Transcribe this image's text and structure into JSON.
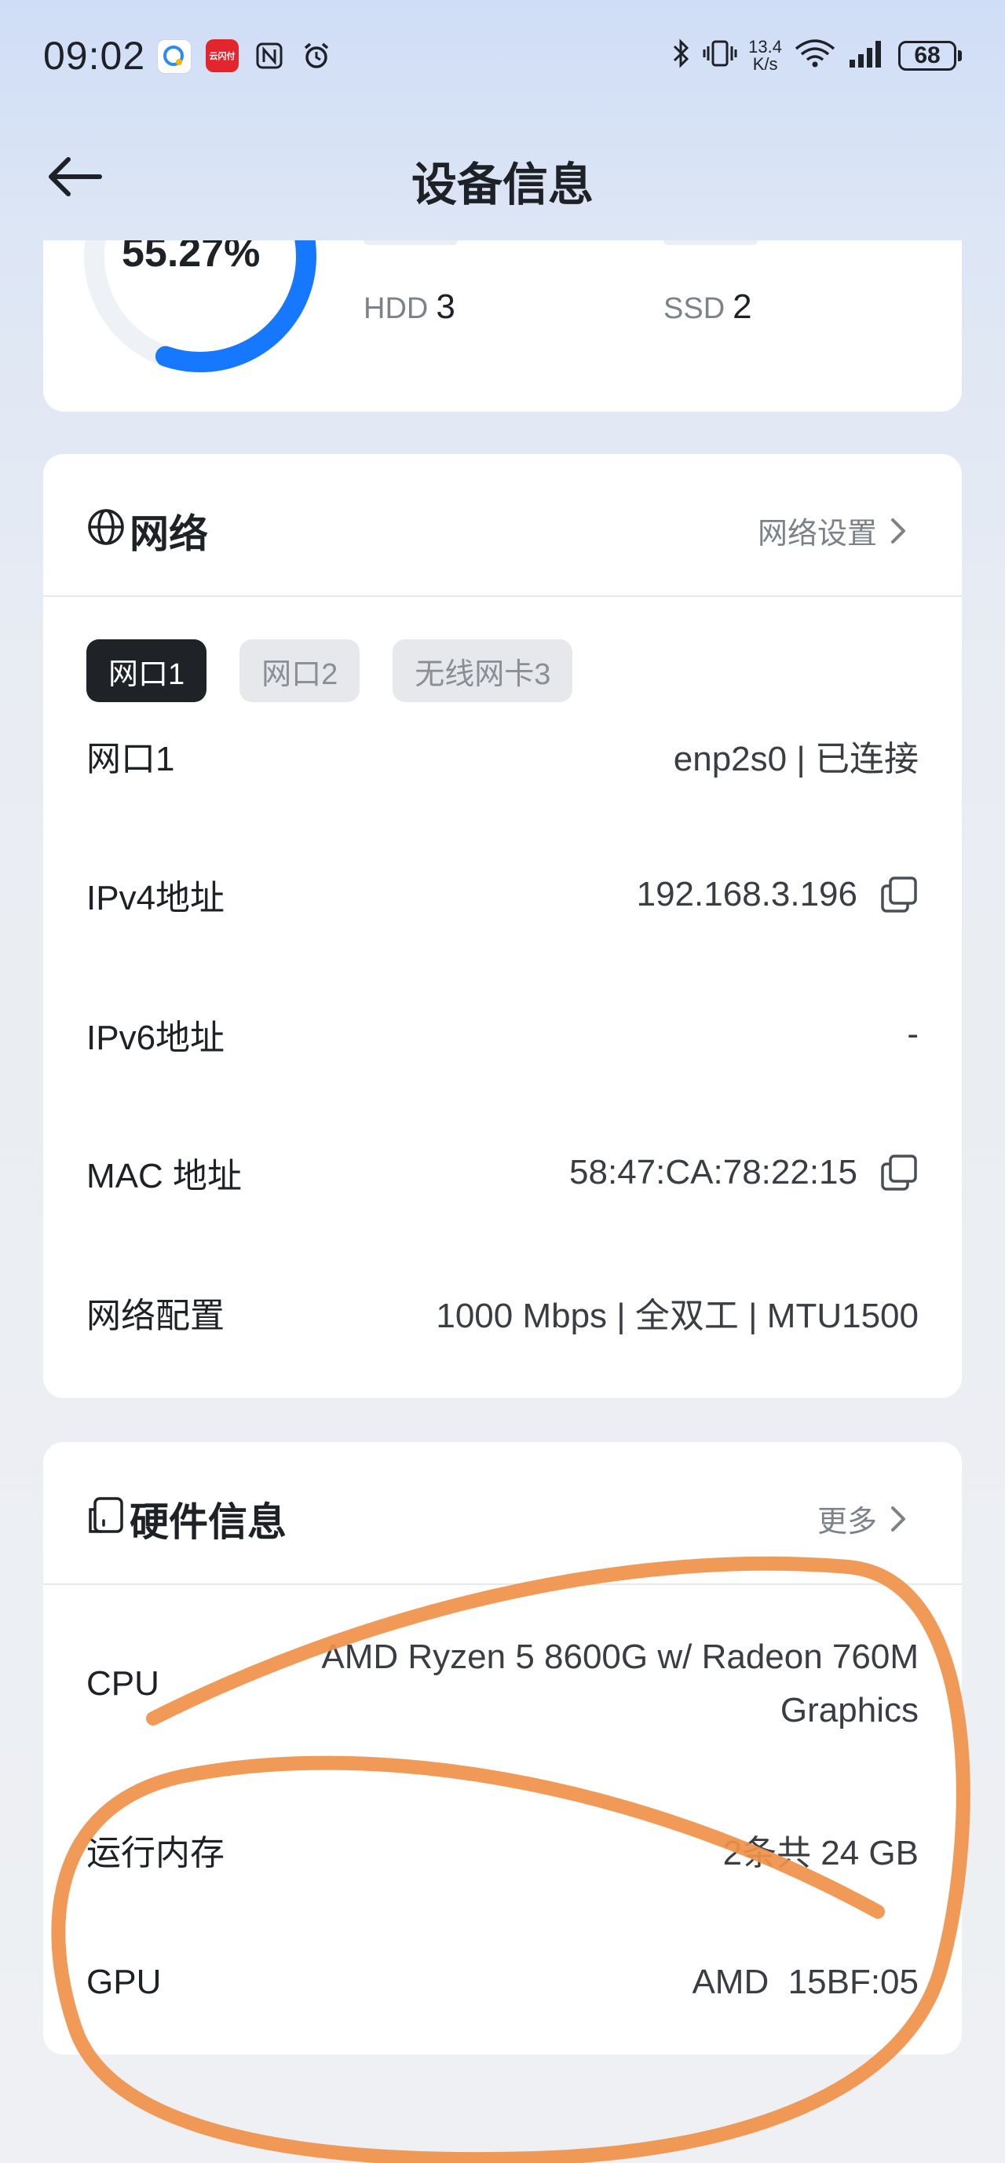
{
  "status_bar": {
    "time": "09:02",
    "net_speed_value": "13.4",
    "net_speed_unit": "K/s",
    "battery": "68",
    "app_icon_2_text": "云闪付"
  },
  "nav": {
    "title": "设备信息"
  },
  "storage": {
    "used_percent": "55.27%",
    "used_fraction": 0.5527,
    "hdd_label": "HDD",
    "hdd_count": "3",
    "ssd_label": "SSD",
    "ssd_count": "2"
  },
  "network": {
    "title": "网络",
    "action": "网络设置",
    "tabs": [
      "网口1",
      "网口2",
      "无线网卡3"
    ],
    "active_tab": 0,
    "rows": [
      {
        "label": "网口1",
        "value": "enp2s0 | 已连接",
        "copy": false
      },
      {
        "label": "IPv4地址",
        "value": "192.168.3.196",
        "copy": true
      },
      {
        "label": "IPv6地址",
        "value": "-",
        "copy": false
      },
      {
        "label": "MAC 地址",
        "value": "58:47:CA:78:22:15",
        "copy": true
      },
      {
        "label": "网络配置",
        "value": "1000 Mbps | 全双工 | MTU1500",
        "copy": false
      }
    ]
  },
  "hardware": {
    "title": "硬件信息",
    "action": "更多",
    "rows": [
      {
        "label": "CPU",
        "value_line1": "AMD Ryzen 5 8600G w/ Radeon 760M",
        "value_line2": "Graphics"
      },
      {
        "label": "运行内存",
        "value": "2条共 24 GB"
      },
      {
        "label": "GPU",
        "value": "AMD  15BF:05"
      }
    ]
  },
  "colors": {
    "accent": "#1677ff",
    "annotation": "#f0914a",
    "tab_active_bg": "#1f2327"
  }
}
